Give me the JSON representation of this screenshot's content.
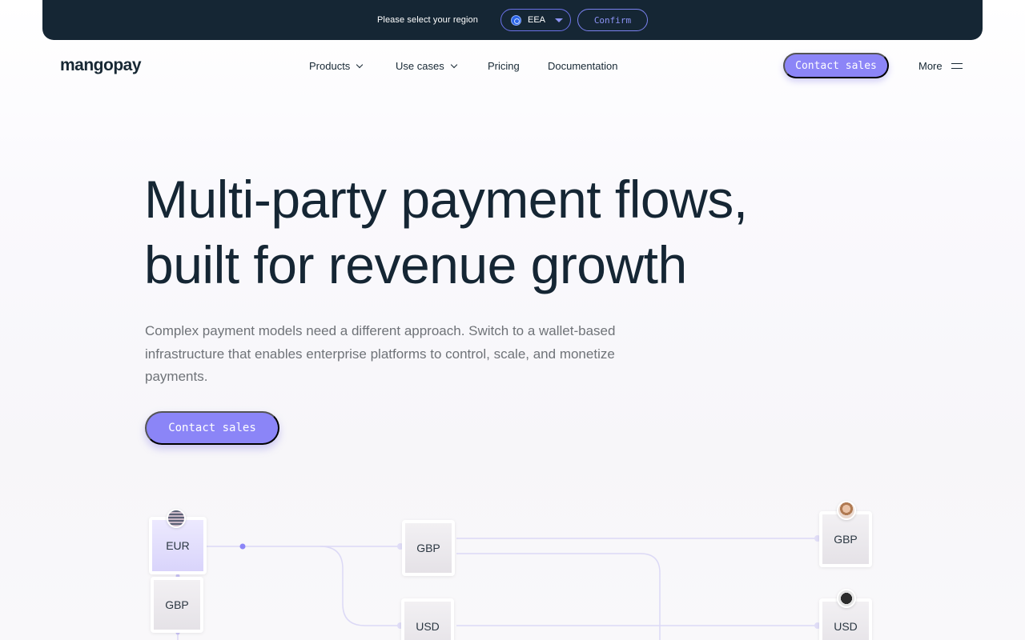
{
  "region_banner": {
    "prompt": "Please select your region",
    "selected_region": "EEA",
    "confirm_label": "Confirm"
  },
  "nav": {
    "logo": "mangopay",
    "items": [
      {
        "label": "Products",
        "has_dropdown": true
      },
      {
        "label": "Use cases",
        "has_dropdown": true
      },
      {
        "label": "Pricing",
        "has_dropdown": false
      },
      {
        "label": "Documentation",
        "has_dropdown": false
      }
    ],
    "contact_label": "Contact sales",
    "more_label": "More"
  },
  "hero": {
    "title_line1": "Multi-party payment flows,",
    "title_line2": "built for revenue growth",
    "subtitle": "Complex payment models need a different approach. Switch to a wallet-based infrastructure that enables enterprise platforms to control, scale, and monetize payments.",
    "cta_label": "Contact sales"
  },
  "diagram": {
    "wallets": [
      {
        "currency": "EUR"
      },
      {
        "currency": "GBP"
      },
      {
        "currency": "GBP"
      },
      {
        "currency": "USD"
      },
      {
        "currency": "GBP"
      },
      {
        "currency": "USD"
      }
    ]
  },
  "colors": {
    "banner_bg": "#152634",
    "accent": "#8b85f7",
    "text_dark": "#152634",
    "text_muted": "#6f7378"
  }
}
